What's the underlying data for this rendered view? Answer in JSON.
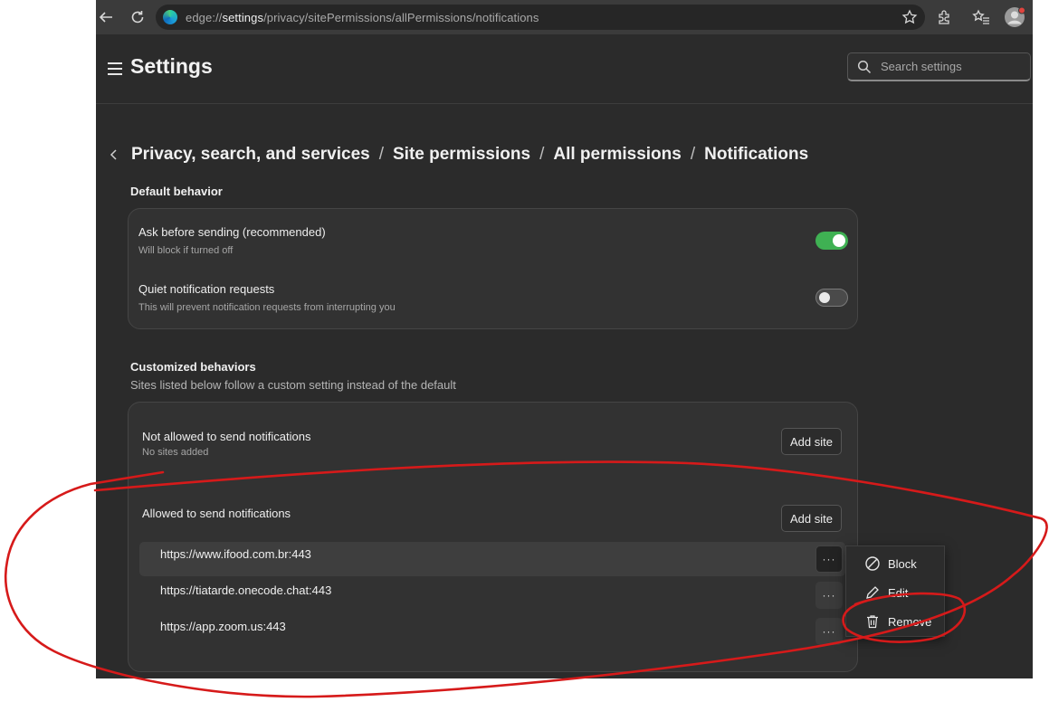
{
  "browser": {
    "url_prefix": "edge://",
    "url_host": "settings",
    "url_path": "/privacy/sitePermissions/allPermissions/notifications"
  },
  "settings": {
    "title": "Settings",
    "search_placeholder": "Search settings"
  },
  "breadcrumb": {
    "items": [
      "Privacy, search, and services",
      "Site permissions",
      "All permissions",
      "Notifications"
    ],
    "separator": "/"
  },
  "default_behavior": {
    "label": "Default behavior",
    "rows": [
      {
        "title": "Ask before sending (recommended)",
        "subtitle": "Will block if turned off",
        "enabled": true
      },
      {
        "title": "Quiet notification requests",
        "subtitle": "This will prevent notification requests from interrupting you",
        "enabled": false
      }
    ]
  },
  "customized": {
    "label": "Customized behaviors",
    "subtitle": "Sites listed below follow a custom setting instead of the default",
    "not_allowed": {
      "title": "Not allowed to send notifications",
      "subtitle": "No sites added",
      "add_label": "Add site"
    },
    "allowed": {
      "title": "Allowed to send notifications",
      "add_label": "Add site",
      "sites": [
        "https://www.ifood.com.br:443",
        "https://tiatarde.onecode.chat:443",
        "https://app.zoom.us:443"
      ],
      "more_label": "···"
    }
  },
  "context_menu": {
    "items": [
      "Block",
      "Edit",
      "Remove"
    ]
  },
  "colors": {
    "toggle_on": "#3fb153",
    "annotation": "#d61a1a"
  }
}
